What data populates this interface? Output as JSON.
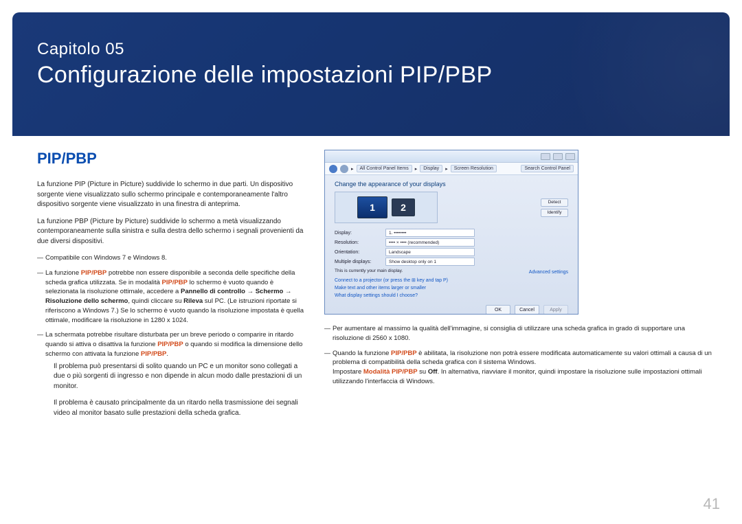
{
  "header": {
    "chapter": "Capitolo 05",
    "title": "Configurazione delle impostazioni PIP/PBP"
  },
  "section_title": "PIP/PBP",
  "left": {
    "p1": "La funzione PIP (Picture in Picture) suddivide lo schermo in due parti. Un dispositivo sorgente viene visualizzato sullo schermo principale e contemporaneamente l'altro dispositivo sorgente viene visualizzato in una finestra di anteprima.",
    "p2": "La funzione PBP (Picture by Picture) suddivide lo schermo a metà visualizzando contemporaneamente sulla sinistra e sulla destra dello schermo i segnali provenienti da due diversi dispositivi.",
    "note1": "Compatibile con Windows 7 e Windows 8.",
    "note2a": "La funzione ",
    "note2b": " potrebbe non essere disponibile a seconda delle specifiche della scheda grafica utilizzata. Se in modalità ",
    "note2c": " lo schermo è vuoto quando è selezionata la risoluzione ottimale, accedere a ",
    "note2d": "Pannello di controllo → Schermo → Risoluzione dello schermo",
    "note2e": ", quindi cliccare su ",
    "note2f": "Rileva",
    "note2g": " sul PC. (Le istruzioni riportate si riferiscono a Windows 7.) Se lo schermo è vuoto quando la risoluzione impostata è quella ottimale, modificare la risoluzione in 1280 x 1024.",
    "note3a": "La schermata potrebbe risultare disturbata per un breve periodo o comparire in ritardo quando si attiva o disattiva la funzione ",
    "note3b": " o quando si modifica la dimensione dello schermo con attivata la funzione ",
    "note3c": ".",
    "note3_sub1": "Il problema può presentarsi di solito quando un PC e un monitor sono collegati a due o più sorgenti di ingresso e non dipende in alcun modo dalle prestazioni di un monitor.",
    "note3_sub2": "Il problema è causato principalmente da un ritardo nella trasmissione dei segnali video al monitor basato sulle prestazioni della scheda grafica."
  },
  "right": {
    "note_r1": "Per aumentare al massimo la qualità dell'immagine, si consiglia di utilizzare una scheda grafica in grado di supportare una risoluzione di 2560 x 1080.",
    "note_r2a": "Quando la funzione ",
    "note_r2b": " è abilitata, la risoluzione non potrà essere modificata automaticamente su valori ottimali a causa di un problema di compatibilità della scheda grafica con il sistema Windows.",
    "note_r2c": "Impostare ",
    "note_r2d": "Modalità PIP/PBP",
    "note_r2e": " su ",
    "note_r2f": "Off",
    "note_r2g": ". In alternativa, riavviare il monitor, quindi impostare la risoluzione sulle impostazioni ottimali utilizzando l'interfaccia di Windows."
  },
  "pip_label": "PIP/PBP",
  "screenshot": {
    "breadcrumb": [
      "All Control Panel Items",
      "Display",
      "Screen Resolution"
    ],
    "search_placeholder": "Search Control Panel",
    "heading": "Change the appearance of your displays",
    "mon1": "1",
    "mon2": "2",
    "detect": "Detect",
    "identify": "Identify",
    "rows": {
      "display_lbl": "Display:",
      "display_val": "1. ••••••••",
      "res_lbl": "Resolution:",
      "res_val": "•••• × •••• (recommended)",
      "orient_lbl": "Orientation:",
      "orient_val": "Landscape",
      "multi_lbl": "Multiple displays:",
      "multi_val": "Show desktop only on 1"
    },
    "main_disp": "This is currently your main display.",
    "adv": "Advanced settings",
    "link_proj": "Connect to a projector (or press the ⊞ key and tap P)",
    "link_text": "Make text and other items larger or smaller",
    "link_what": "What display settings should I choose?",
    "ok": "OK",
    "cancel": "Cancel",
    "apply": "Apply"
  },
  "page_number": "41"
}
